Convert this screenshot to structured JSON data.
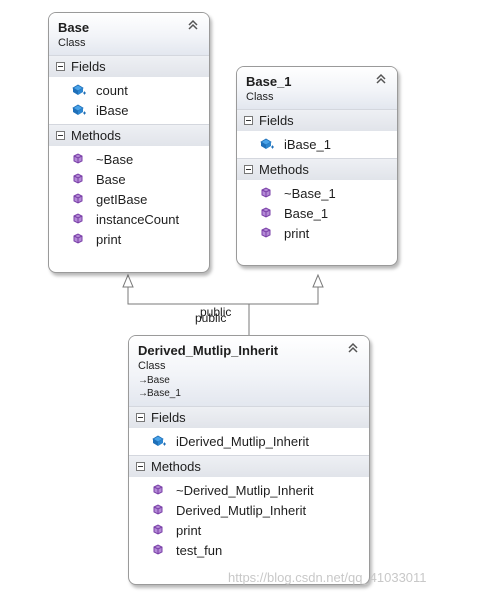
{
  "classes": {
    "base": {
      "name": "Base",
      "stereotype": "Class",
      "fields_label": "Fields",
      "methods_label": "Methods",
      "fields": [
        "count",
        "iBase"
      ],
      "methods": [
        "~Base",
        "Base",
        "getIBase",
        "instanceCount",
        "print"
      ]
    },
    "base1": {
      "name": "Base_1",
      "stereotype": "Class",
      "fields_label": "Fields",
      "methods_label": "Methods",
      "fields": [
        "iBase_1"
      ],
      "methods": [
        "~Base_1",
        "Base_1",
        "print"
      ]
    },
    "derived": {
      "name": "Derived_Mutlip_Inherit",
      "stereotype": "Class",
      "bases": [
        "Base",
        "Base_1"
      ],
      "fields_label": "Fields",
      "methods_label": "Methods",
      "fields": [
        "iDerived_Mutlip_Inherit"
      ],
      "methods": [
        "~Derived_Mutlip_Inherit",
        "Derived_Mutlip_Inherit",
        "print",
        "test_fun"
      ]
    }
  },
  "connector": {
    "label_a": "public",
    "label_b": "public"
  },
  "watermark": "https://blog.csdn.net/qq_41033011",
  "icons": {
    "field": "field-icon",
    "method": "method-icon",
    "collapse": "chevron-up-icon"
  },
  "colors": {
    "field_icon": "#1f6fb8",
    "method_icon": "#7a3fa8",
    "line": "#7a7a7a"
  }
}
